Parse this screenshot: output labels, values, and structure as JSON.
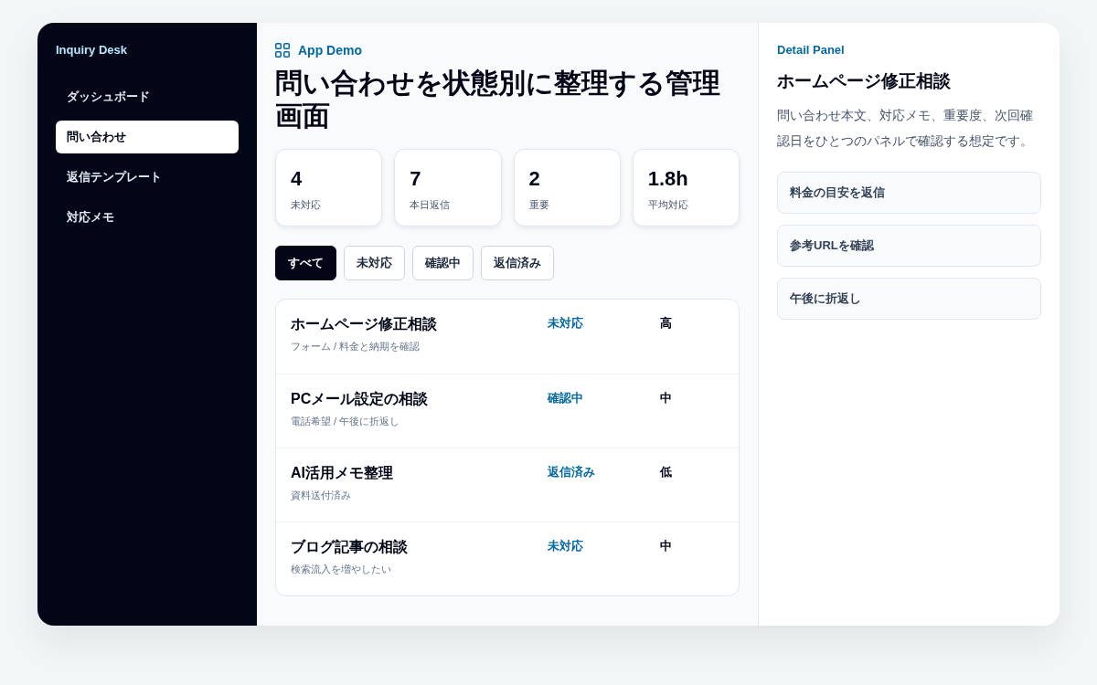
{
  "sidebar": {
    "title": "Inquiry Desk",
    "items": [
      {
        "label": "ダッシュボード",
        "selected": false
      },
      {
        "label": "問い合わせ",
        "selected": true
      },
      {
        "label": "返信テンプレート",
        "selected": false
      },
      {
        "label": "対応メモ",
        "selected": false
      }
    ]
  },
  "header": {
    "eyebrow": "App Demo",
    "title": "問い合わせを状態別に整理する管理画面"
  },
  "stats": [
    {
      "value": "4",
      "label": "未対応"
    },
    {
      "value": "7",
      "label": "本日返信"
    },
    {
      "value": "2",
      "label": "重要"
    },
    {
      "value": "1.8h",
      "label": "平均対応"
    }
  ],
  "filters": [
    {
      "label": "すべて",
      "selected": true
    },
    {
      "label": "未対応",
      "selected": false
    },
    {
      "label": "確認中",
      "selected": false
    },
    {
      "label": "返信済み",
      "selected": false
    }
  ],
  "inquiries": [
    {
      "title": "ホームページ修正相談",
      "note": "フォーム / 料金と納期を確認",
      "status": "未対応",
      "priority": "高"
    },
    {
      "title": "PCメール設定の相談",
      "note": "電話希望 / 午後に折返し",
      "status": "確認中",
      "priority": "中"
    },
    {
      "title": "AI活用メモ整理",
      "note": "資料送付済み",
      "status": "返信済み",
      "priority": "低"
    },
    {
      "title": "ブログ記事の相談",
      "note": "検索流入を増やしたい",
      "status": "未対応",
      "priority": "中"
    }
  ],
  "detail_panel": {
    "eyebrow": "Detail Panel",
    "title": "ホームページ修正相談",
    "description": "問い合わせ本文、対応メモ、重要度、次回確認日をひとつのパネルで確認する想定です。",
    "actions": [
      "料金の目安を返信",
      "参考URLを確認",
      "午後に折返し"
    ]
  }
}
